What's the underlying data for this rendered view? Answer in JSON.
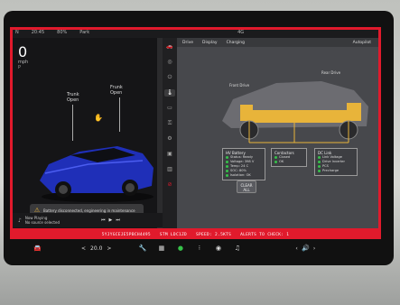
{
  "status_bar": {
    "items": [
      "N",
      "20:45",
      "80%",
      "",
      "Park",
      "",
      "",
      "",
      "4G"
    ]
  },
  "left_panel": {
    "speed": "0",
    "speed_unit": "mph",
    "gear_letter": "P",
    "label_trunk": "Trunk\nOpen",
    "label_frunk": "Frunk\nOpen",
    "warning_text": "Battery disconnected, engineering in maintenance",
    "media_text": "Now Playing\nNo source selected"
  },
  "sidebar": {
    "icons": [
      "car-icon",
      "steering-icon",
      "power-icon",
      "thermometer-icon",
      "seat-icon",
      "key-icon",
      "gear-icon",
      "camera-icon",
      "trash-icon",
      "stop-icon"
    ]
  },
  "main": {
    "nav": [
      "Drive",
      "Display",
      "Charging",
      "Autopilot"
    ],
    "diagram": {
      "box1": {
        "title": "HV Battery",
        "rows": [
          "Status: Ready",
          "Voltage: 398 V",
          "Temp: 24 C",
          "SOC: 80%",
          "Isolation: OK"
        ]
      },
      "box2": {
        "title": "Contactors",
        "rows": [
          "Closed",
          "OK"
        ]
      },
      "box3": {
        "title": "DC Link",
        "rows": [
          "Link Voltage",
          "Drive Inverter",
          "PCS",
          "Precharge"
        ]
      },
      "reset_button": "CLEAR\nALL"
    }
  },
  "alert_strip": {
    "parts": [
      "5YJYGCEJE5PBCH4495",
      "STM LDC1ZD",
      "SPEED: 2.5KTS",
      "ALERTS TO CHECK: 1"
    ]
  },
  "bottom_bar": {
    "temp": "20.0",
    "climate_left": "<",
    "climate_right": ">",
    "volume_icon": "volume-icon"
  },
  "colors": {
    "alert_red": "#e11a2c",
    "car_blue": "#1f2fb8",
    "battery_yellow": "#e8b43a",
    "status_green": "#36c24a"
  }
}
